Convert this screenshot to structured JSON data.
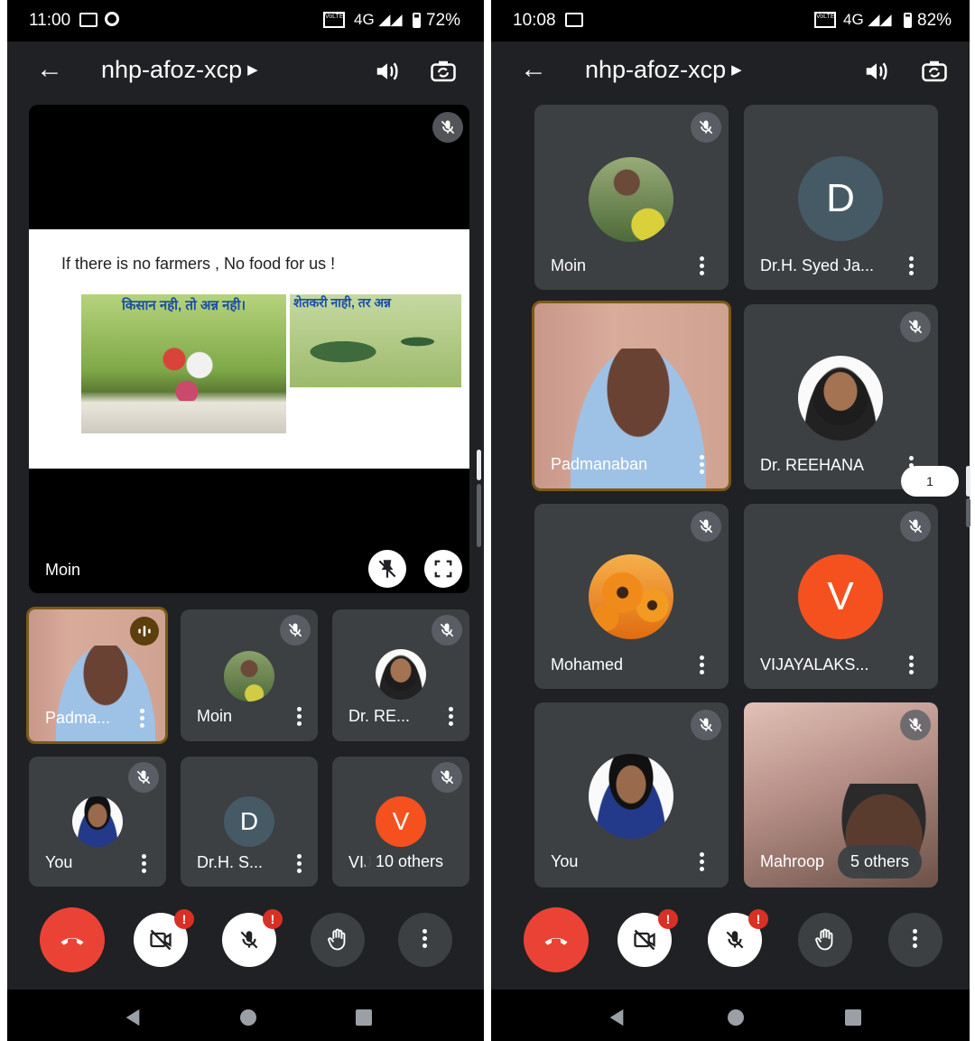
{
  "left": {
    "status": {
      "time": "11:00",
      "battery": "72%"
    },
    "meeting_code": "nhp-afoz-xcp",
    "presentation": {
      "presenter": "Moin",
      "slide_title": "If there is no farmers , No food for us !",
      "slide_caption_1": "किसान नही, तो अन्न नही।",
      "slide_caption_2": "शेतकरी नाही, तर अन्न"
    },
    "participants": [
      {
        "name": "Padma...",
        "speaking": true
      },
      {
        "name": "Moin"
      },
      {
        "name": "Dr. RE..."
      },
      {
        "name": "You"
      },
      {
        "name": "Dr.H. S...",
        "avatar_letter": "D"
      },
      {
        "name": "VIJ",
        "avatar_letter": "V"
      }
    ],
    "others_label": "10 others"
  },
  "right": {
    "status": {
      "time": "10:08",
      "battery": "82%"
    },
    "meeting_code": "nhp-afoz-xcp",
    "participants": [
      {
        "name": "Moin"
      },
      {
        "name": "Dr.H. Syed Ja...",
        "avatar_letter": "D"
      },
      {
        "name": "Padmanaban"
      },
      {
        "name": "Dr. REEHANA"
      },
      {
        "name": "Mohamed"
      },
      {
        "name": "VIJAYALAKS...",
        "avatar_letter": "V"
      },
      {
        "name": "You"
      },
      {
        "name": "Mahroop"
      }
    ],
    "others_label": "5 others",
    "page_indicator": "1"
  },
  "colors": {
    "end_call": "#ea4335",
    "avatar_d": "#455a64",
    "avatar_v": "#f4511e",
    "badge": "#d93025",
    "active_border": "#7a5a18"
  },
  "icons": [
    "back-arrow-icon",
    "speaker-icon",
    "switch-camera-icon",
    "mic-off-icon",
    "unpin-icon",
    "fullscreen-icon",
    "end-call-icon",
    "camera-off-icon",
    "raise-hand-icon",
    "more-options-icon",
    "nav-back-icon",
    "nav-home-icon",
    "nav-recents-icon"
  ]
}
